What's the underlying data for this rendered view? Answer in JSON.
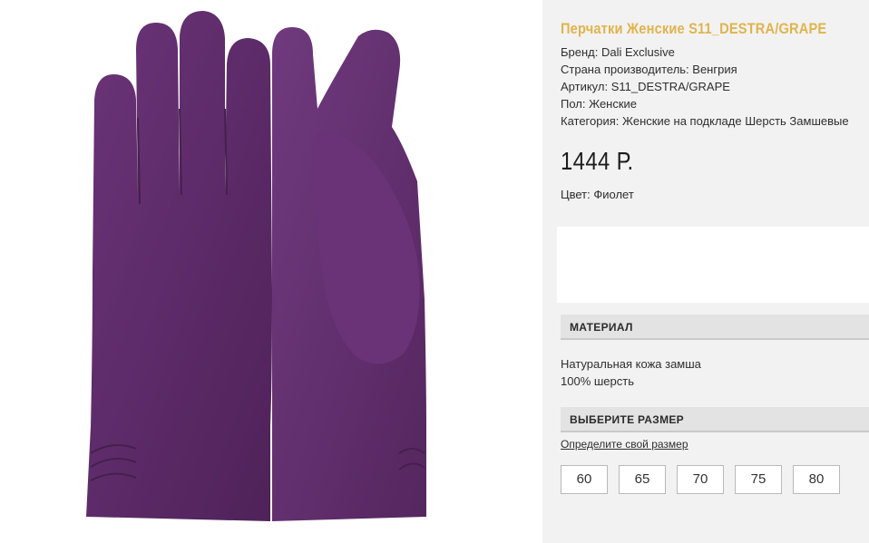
{
  "product": {
    "title": "Перчатки Женские S11_DESTRA/GRAPE",
    "brand_line": "Бренд: Dali Exclusive",
    "country_line": "Страна производитель: Венгрия",
    "article_line": "Артикул: S11_DESTRA/GRAPE",
    "gender_line": "Пол: Женские",
    "category_line": "Категория: Женские на подкладе Шерсть Замшевые",
    "price": "1444 Р.",
    "color_line": "Цвет: Фиолет",
    "image_color": "#5e2a6b"
  },
  "material": {
    "heading": "МАТЕРИАЛ",
    "lines": [
      "Натуральная кожа замша",
      "100% шерсть"
    ]
  },
  "sizes": {
    "heading": "ВЫБЕРИТЕ РАЗМЕР",
    "link": "Определите свой размер",
    "options": [
      "60",
      "65",
      "70",
      "75",
      "80"
    ]
  },
  "colors": {
    "accent": "#e0b44c",
    "panel": "#f2f2f2",
    "section_bg": "#e3e3e3"
  }
}
